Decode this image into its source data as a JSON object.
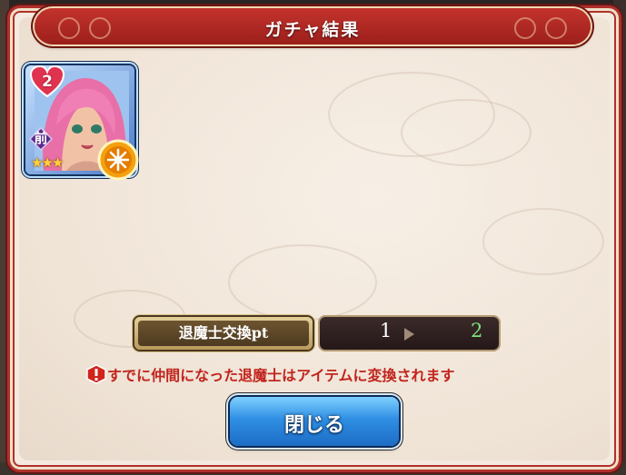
{
  "dialog": {
    "title": "ガチャ結果"
  },
  "card": {
    "affection_level": "2",
    "position_label": "前",
    "stars": "★★★",
    "element_icon": "sun-element-icon"
  },
  "exchange": {
    "label": "退魔士交換pt",
    "from_value": "1",
    "to_value": "2"
  },
  "notice": {
    "text": "すでに仲間になった退魔士はアイテムに変換されます"
  },
  "buttons": {
    "close_label": "閉じる"
  },
  "colors": {
    "title_bar": "#b0302c",
    "close_button": "#2f8fe3",
    "warning": "#c1241d",
    "to_value": "#7fe07f"
  }
}
